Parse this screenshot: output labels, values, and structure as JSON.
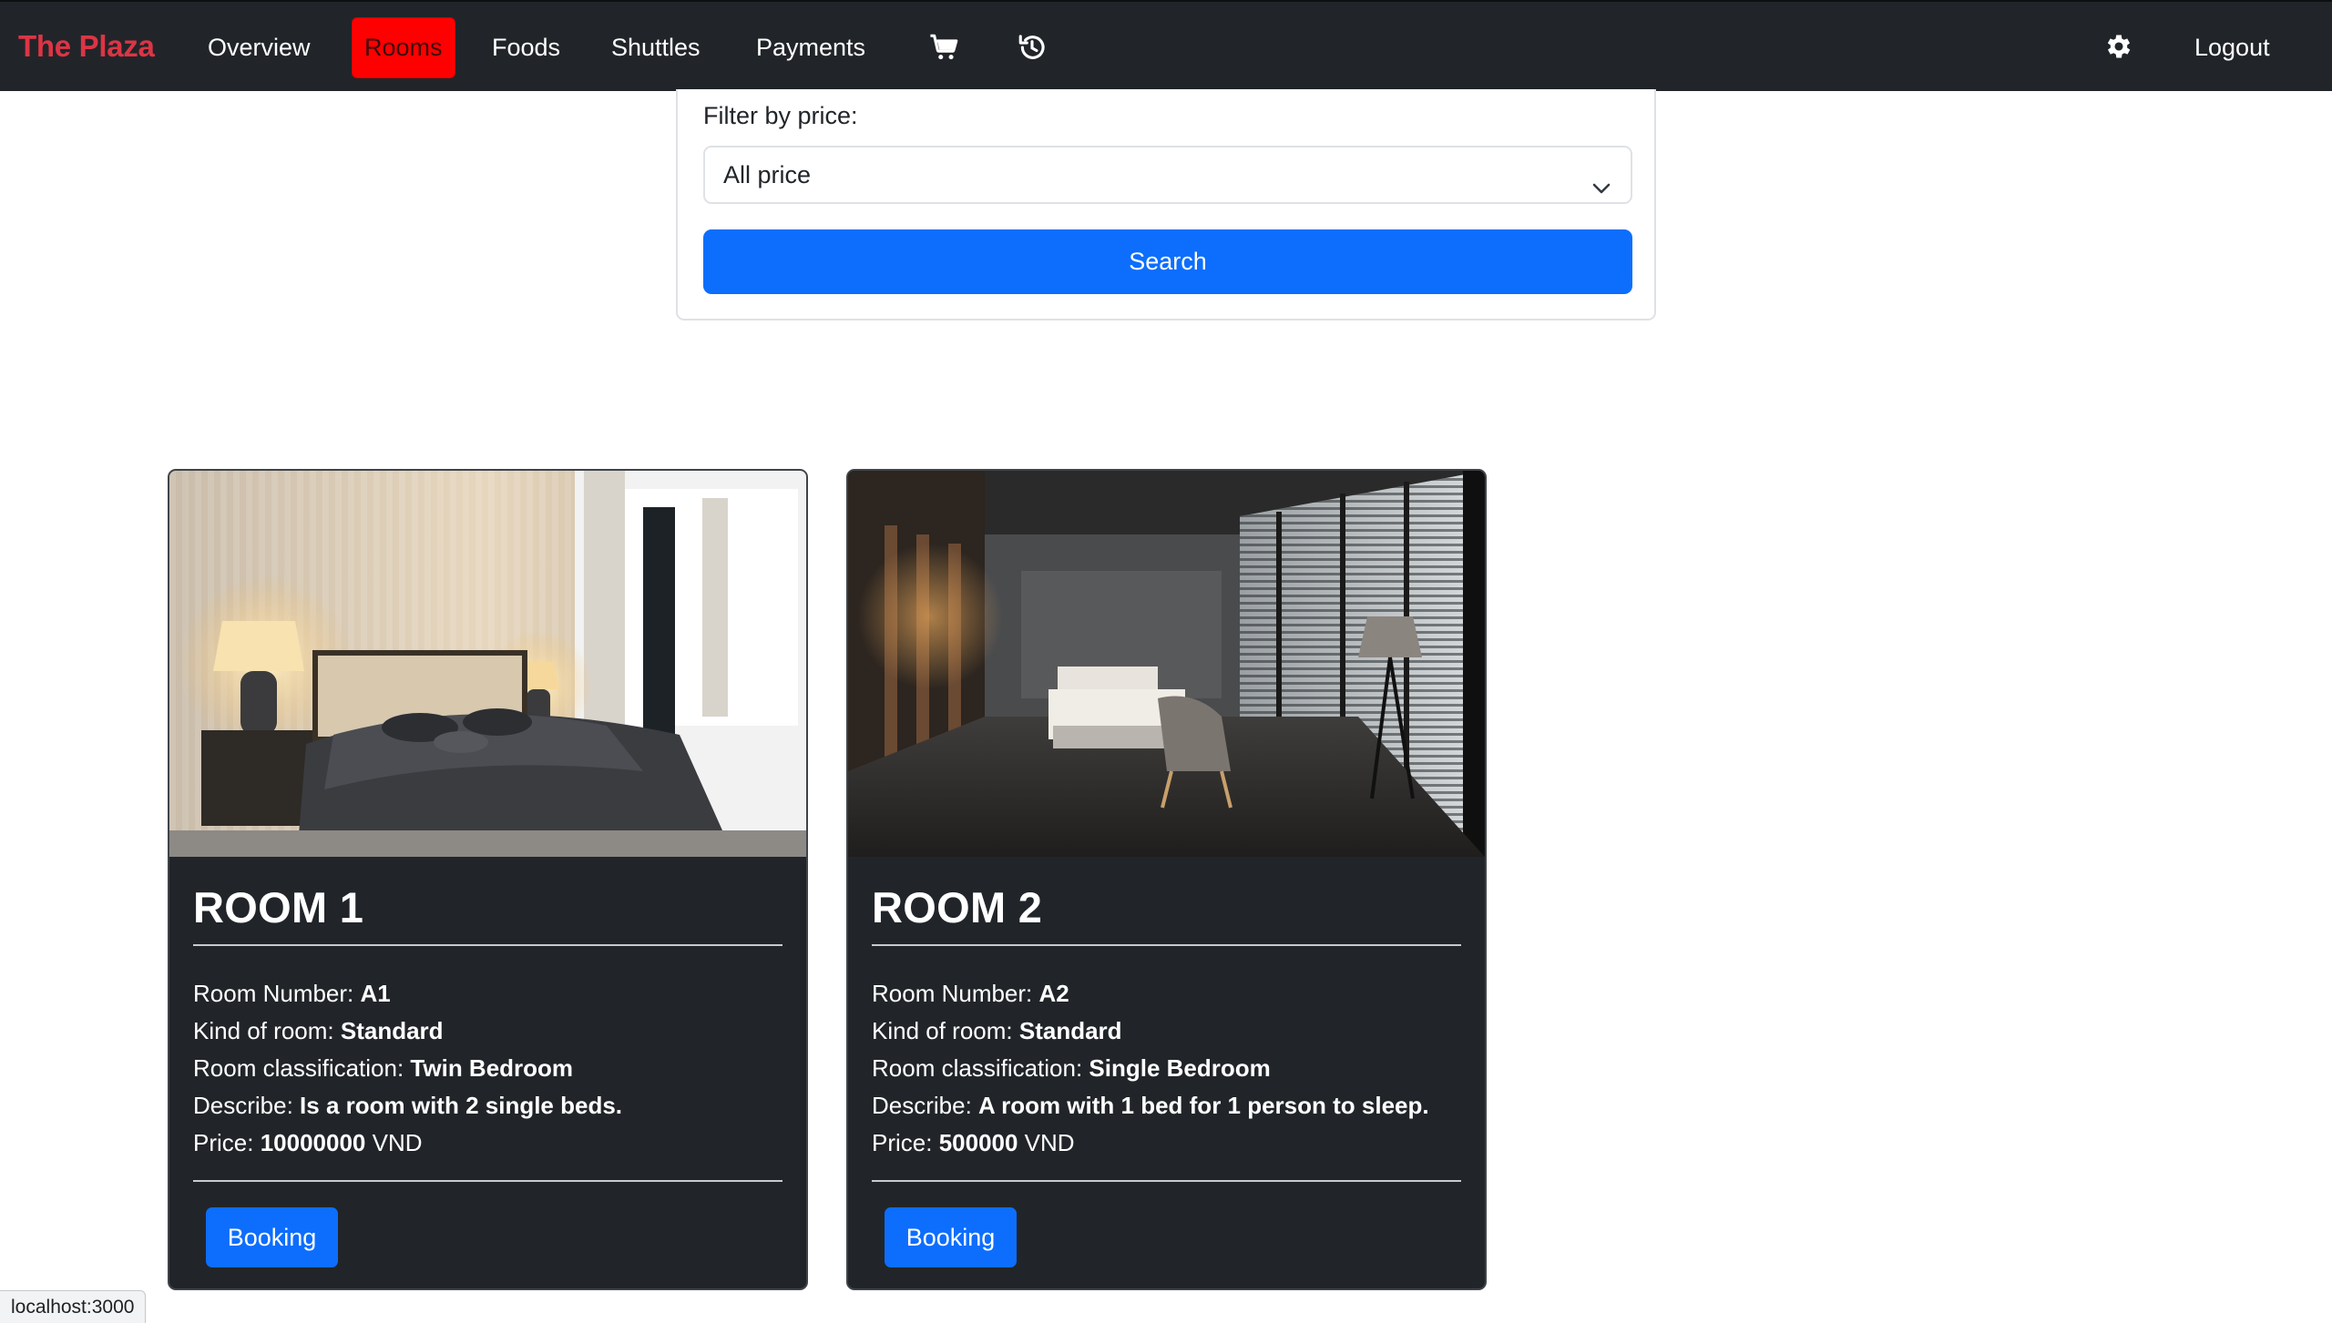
{
  "navbar": {
    "brand": "The Plaza",
    "links": [
      {
        "label": "Overview"
      },
      {
        "label": "Rooms",
        "active": true
      },
      {
        "label": "Foods"
      },
      {
        "label": "Shuttles"
      },
      {
        "label": "Payments"
      }
    ],
    "icons": [
      "cart-icon",
      "history-icon",
      "gear-icon"
    ],
    "logout": "Logout",
    "colors": {
      "background": "#212529",
      "brand": "#dc3545",
      "active": "#ff0000"
    }
  },
  "filter": {
    "label": "Filter by price:",
    "selected": "All price",
    "search_label": "Search"
  },
  "rooms": [
    {
      "title": "ROOM 1",
      "number_label": "Room Number: ",
      "number": "A1",
      "kind_label": "Kind of room: ",
      "kind": "Standard",
      "class_label": "Room classification: ",
      "classification": "Twin Bedroom",
      "describe_label": "Describe: ",
      "describe": "Is a room with 2 single beds.",
      "price_label": "Price: ",
      "price": "10000000",
      "currency": " VND",
      "booking_label": "Booking"
    },
    {
      "title": "ROOM 2",
      "number_label": "Room Number: ",
      "number": "A2",
      "kind_label": "Kind of room: ",
      "kind": "Standard",
      "class_label": "Room classification: ",
      "classification": "Single Bedroom",
      "describe_label": "Describe: ",
      "describe": "A room with 1 bed for 1 person to sleep.",
      "price_label": "Price: ",
      "price": "500000",
      "currency": " VND",
      "booking_label": "Booking"
    }
  ],
  "status_url": "localhost:3000",
  "accent_color": "#0d6efd"
}
